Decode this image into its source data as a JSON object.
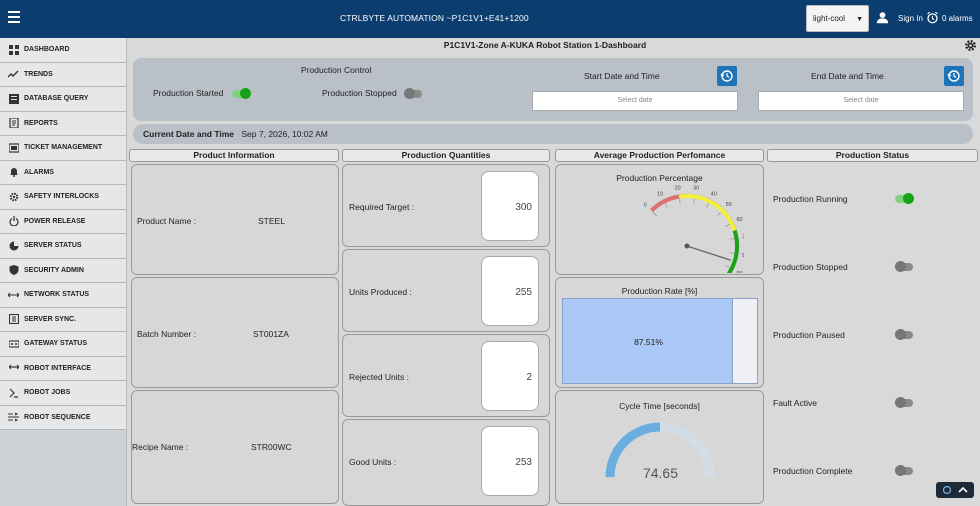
{
  "header": {
    "app_title": "CTRLBYTE AUTOMATION ~P1C1V1+E41+1200",
    "theme": "light-cool",
    "sign_in": "Sign In",
    "alarms": "0 alarms"
  },
  "sidebar": {
    "items": [
      {
        "label": "DASHBOARD",
        "icon": "dashboard-icon"
      },
      {
        "label": "TRENDS",
        "icon": "trend-line-icon"
      },
      {
        "label": "DATABASE QUERY",
        "icon": "database-icon"
      },
      {
        "label": "REPORTS",
        "icon": "report-icon"
      },
      {
        "label": "TICKET MANAGEMENT",
        "icon": "ticket-icon"
      },
      {
        "label": "ALARMS",
        "icon": "bell-icon"
      },
      {
        "label": "SAFETY INTERLOCKS",
        "icon": "gear-icon"
      },
      {
        "label": "POWER RELEASE",
        "icon": "power-icon"
      },
      {
        "label": "SERVER STATUS",
        "icon": "pie-icon"
      },
      {
        "label": "SECURITY ADMIN",
        "icon": "shield-icon"
      },
      {
        "label": "NETWORK STATUS",
        "icon": "arrows-icon"
      },
      {
        "label": "SERVER SYNC.",
        "icon": "sync-icon"
      },
      {
        "label": "GATEWAY STATUS",
        "icon": "gateway-icon"
      },
      {
        "label": "ROBOT INTERFACE",
        "icon": "robot-icon"
      },
      {
        "label": "ROBOT JOBS",
        "icon": "jobs-icon"
      },
      {
        "label": "ROBOT SEQUENCE",
        "icon": "sequence-icon"
      }
    ]
  },
  "page": {
    "title": "P1C1V1-Zone A-KUKA Robot Station 1-Dashboard"
  },
  "production_control": {
    "title": "Production Control",
    "started_label": "Production Started",
    "started_on": true,
    "stopped_label": "Production Stopped",
    "stopped_on": false,
    "start_label": "Start Date and Time",
    "end_label": "End Date and Time",
    "start_placeholder": "Select date",
    "end_placeholder": "Select date"
  },
  "current": {
    "label": "Current Date and Time",
    "value": "Sep 7, 2026, 10:02 AM"
  },
  "product_info": {
    "title": "Product Information",
    "rows": [
      {
        "label": "Product Name :",
        "value": "STEEL"
      },
      {
        "label": "Batch Number :",
        "value": "ST001ZA"
      },
      {
        "label": "Recipe Name :",
        "value": "STR00WC"
      }
    ]
  },
  "quantities": {
    "title": "Production Quantities",
    "rows": [
      {
        "label": "Required Target :",
        "value": "300"
      },
      {
        "label": "Units Produced :",
        "value": "255"
      },
      {
        "label": "Rejected Units :",
        "value": "2"
      },
      {
        "label": "Good Units :",
        "value": "253"
      }
    ]
  },
  "performance": {
    "title": "Average Production Perfomance",
    "percentage_title": "Production Percentage",
    "percentage_value": 85,
    "gauge_ticks": [
      "0",
      "10",
      "20",
      "30",
      "40",
      "50",
      "60",
      "70",
      "80",
      "90",
      "100"
    ],
    "rate_title": "Production Rate [%]",
    "rate_value": 87.51,
    "rate_text": "87.51%",
    "cycle_title": "Cycle Time [seconds]",
    "cycle_value": "74.65",
    "cycle_fraction": 0.5
  },
  "status": {
    "title": "Production Status",
    "items": [
      {
        "label": "Production Running",
        "on": true
      },
      {
        "label": "Production Stopped",
        "on": false
      },
      {
        "label": "Production Paused",
        "on": false
      },
      {
        "label": "Fault Active",
        "on": false
      },
      {
        "label": "Production Complete",
        "on": false
      }
    ]
  },
  "colors": {
    "header": "#0b3e6f",
    "accent": "#1f73b7",
    "on": "#17a317",
    "gauge_red": "#e07070",
    "gauge_yellow": "#f3f03a",
    "gauge_green": "#19a319",
    "cycle_arc": "#6aaee0"
  }
}
